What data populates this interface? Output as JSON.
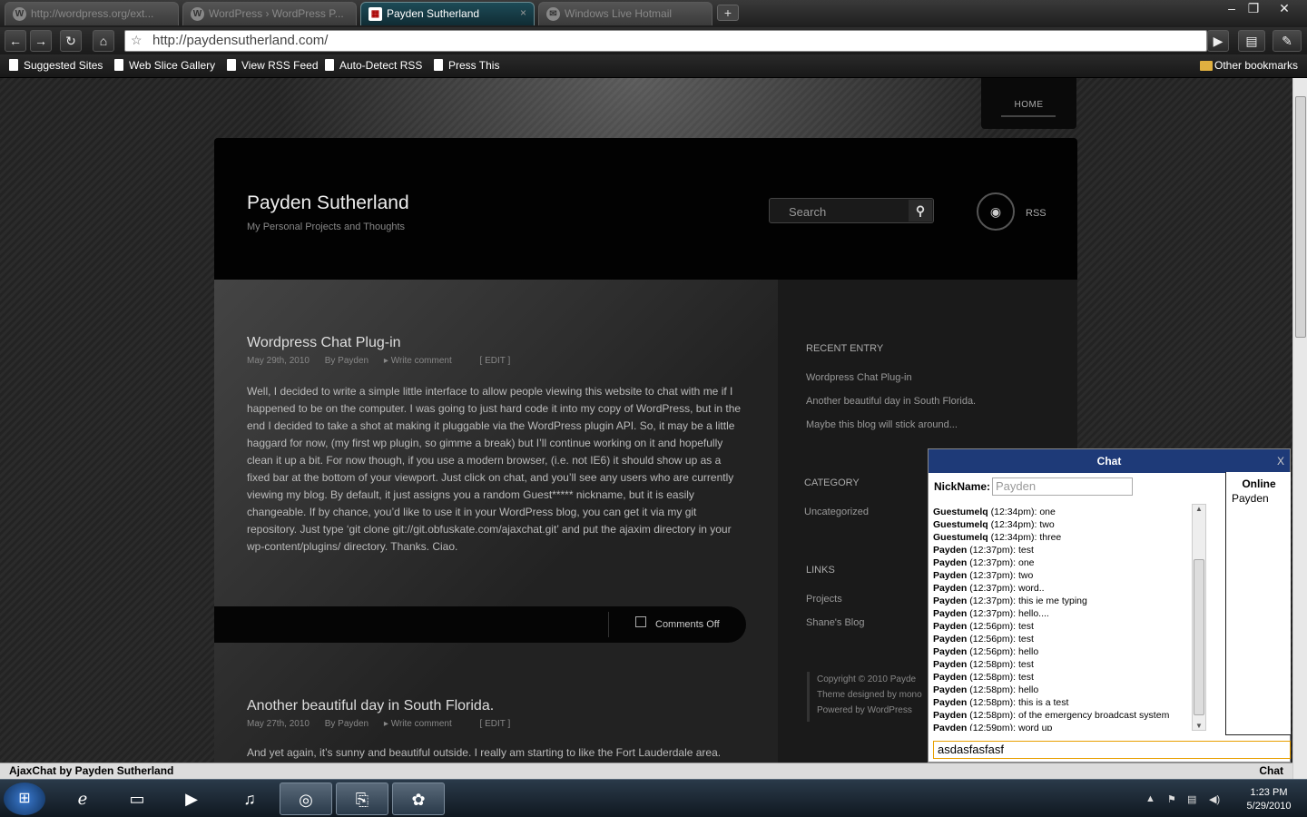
{
  "browser": {
    "tabs": [
      {
        "title": "http://wordpress.org/ext...",
        "icon": "wordpress-icon"
      },
      {
        "title": "WordPress › WordPress P...",
        "icon": "wordpress-icon"
      },
      {
        "title": "Payden Sutherland",
        "icon": "site-icon",
        "active": true
      },
      {
        "title": "Windows Live Hotmail",
        "icon": "hotmail-icon"
      }
    ],
    "new_tab": "+",
    "url": "http://paydensutherland.com/",
    "bookmarks": [
      "Suggested Sites",
      "Web Slice Gallery",
      "View RSS Feed",
      "Auto-Detect RSS",
      "Press This"
    ],
    "other_bookmarks": "Other bookmarks"
  },
  "site": {
    "nav_home": "HOME",
    "title": "Payden Sutherland",
    "tagline": "My Personal Projects and Thoughts",
    "search_placeholder": "Search",
    "rss": "RSS"
  },
  "posts": [
    {
      "title": "Wordpress Chat Plug-in",
      "date": "May 29th, 2010",
      "author": "By Payden",
      "comment_link": "Write comment",
      "edit": "[ EDIT ]",
      "body": "Well, I decided to write  a simple little interface to allow people viewing this website to chat with me if I happened to be on the computer.  I was going to just hard code it into my copy of WordPress, but in the end I decided to take a shot at making it pluggable via the WordPress plugin API.  So, it may be a little haggard for now, (my first wp plugin, so gimme a break) but I’ll continue working on it and hopefully clean it up a bit.  For now though, if you use a modern browser, (i.e. not IE6) it should show up as a fixed bar at the bottom of your viewport.  Just click on chat, and you’ll see any users who are currently viewing my blog.  By default, it just assigns you a random Guest***** nickname, but it is easily changeable.  If by chance, you’d like to use it in your WordPress blog, you can get it via my git repository.  Just type ‘git clone git://git.obfuskate.com/ajaxchat.git’ and put the ajaxim directory in your wp-content/plugins/ directory.  Thanks.  Ciao.",
      "comments": "Comments Off"
    },
    {
      "title": "Another beautiful day in South Florida.",
      "date": "May 27th, 2010",
      "author": "By Payden",
      "comment_link": "Write comment",
      "edit": "[ EDIT ]",
      "body": "And yet again, it’s sunny and beautiful outside.  I really am starting to like the Fort Lauderdale area."
    }
  ],
  "sidebar": {
    "recent_heading": "RECENT ENTRY",
    "recent": [
      "Wordpress Chat Plug-in",
      "Another beautiful day in South Florida.",
      "Maybe this blog will stick around..."
    ],
    "category_heading": "CATEGORY",
    "categories": [
      "Uncategorized"
    ],
    "links_heading": "LINKS",
    "links": [
      "Projects",
      "Shane's Blog"
    ],
    "footer": [
      "Copyright ©  2010  Payde",
      "Theme designed by mono",
      "Powered by WordPress"
    ]
  },
  "chat": {
    "title": "Chat",
    "close": "X",
    "nick_label": "NickName:",
    "nick_placeholder": "Payden",
    "online_heading": "Online",
    "online_users": [
      "Payden"
    ],
    "messages": [
      {
        "user": "Guestumelq",
        "time": "(12:34pm):",
        "text": "one"
      },
      {
        "user": "Guestumelq",
        "time": "(12:34pm):",
        "text": "two"
      },
      {
        "user": "Guestumelq",
        "time": "(12:34pm):",
        "text": "three"
      },
      {
        "user": "Payden",
        "time": "(12:37pm):",
        "text": "test"
      },
      {
        "user": "Payden",
        "time": "(12:37pm):",
        "text": "one"
      },
      {
        "user": "Payden",
        "time": "(12:37pm):",
        "text": "two"
      },
      {
        "user": "Payden",
        "time": "(12:37pm):",
        "text": "word.."
      },
      {
        "user": "Payden",
        "time": "(12:37pm):",
        "text": "this ie me typing"
      },
      {
        "user": "Payden",
        "time": "(12:37pm):",
        "text": "hello...."
      },
      {
        "user": "Payden",
        "time": "(12:56pm):",
        "text": "test"
      },
      {
        "user": "Payden",
        "time": "(12:56pm):",
        "text": "test"
      },
      {
        "user": "Payden",
        "time": "(12:56pm):",
        "text": "hello"
      },
      {
        "user": "Payden",
        "time": "(12:58pm):",
        "text": "test"
      },
      {
        "user": "Payden",
        "time": "(12:58pm):",
        "text": "test"
      },
      {
        "user": "Payden",
        "time": "(12:58pm):",
        "text": "hello"
      },
      {
        "user": "Payden",
        "time": "(12:58pm):",
        "text": "this is a test"
      },
      {
        "user": "Payden",
        "time": "(12:58pm):",
        "text": "of the emergency broadcast system"
      },
      {
        "user": "Payden",
        "time": "(12:59pm):",
        "text": "word up"
      }
    ],
    "input_value": "asdasfasfasf"
  },
  "ajaxbar": {
    "left": "AjaxChat by Payden Sutherland",
    "right": "Chat"
  },
  "taskbar": {
    "time": "1:23 PM",
    "date": "5/29/2010"
  }
}
